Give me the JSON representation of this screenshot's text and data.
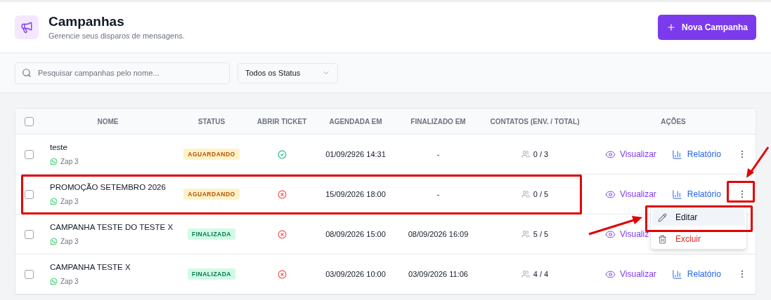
{
  "header": {
    "title": "Campanhas",
    "subtitle": "Gerencie seus disparos de mensagens.",
    "new_button": "Nova Campanha"
  },
  "filters": {
    "search_placeholder": "Pesquisar campanhas pelo nome...",
    "status_select": "Todos os Status"
  },
  "table": {
    "select_all_checked": false,
    "columns": [
      "NOME",
      "STATUS",
      "ABRIR TICKET",
      "AGENDADA EM",
      "FINALIZADO EM",
      "CONTATOS (ENV. / TOTAL)",
      "AÇÕES"
    ],
    "rows": [
      {
        "checked": false,
        "name": "teste",
        "connection": "Zap 3",
        "status": {
          "kind": "pending",
          "label": "AGUARDANDO"
        },
        "open_ticket": true,
        "scheduled": "01/09/2926 14:31",
        "finished": "-",
        "contacts": "0 / 3",
        "actions": [
          {
            "kind": "view",
            "label": "Visualizar"
          },
          {
            "kind": "report",
            "label": "Relatório"
          }
        ],
        "more_button": true
      },
      {
        "checked": false,
        "name": "PROMOÇÃO SETEMBRO 2026",
        "connection": "Zap 3",
        "status": {
          "kind": "pending",
          "label": "AGUARDANDO"
        },
        "open_ticket": false,
        "scheduled": "15/09/2026 18:00",
        "finished": "-",
        "contacts": "0 / 5",
        "actions": [
          {
            "kind": "view",
            "label": "Visualizar"
          },
          {
            "kind": "report",
            "label": "Relatório"
          }
        ],
        "more_button": true
      },
      {
        "checked": false,
        "name": "CAMPANHA TESTE DO TESTE X",
        "connection": "Zap 3",
        "status": {
          "kind": "done",
          "label": "FINALIZADA"
        },
        "open_ticket": false,
        "scheduled": "08/09/2026 15:00",
        "finished": "08/09/2026 16:09",
        "contacts": "5 / 5",
        "actions": [
          {
            "kind": "view",
            "label": "Visualiz"
          }
        ],
        "more_button": false
      },
      {
        "checked": false,
        "name": "CAMPANHA TESTE X",
        "connection": "Zap 3",
        "status": {
          "kind": "done",
          "label": "FINALIZADA"
        },
        "open_ticket": false,
        "scheduled": "03/09/2026 10:00",
        "finished": "03/09/2026 11:06",
        "contacts": "4 / 4",
        "actions": [
          {
            "kind": "view",
            "label": "Visualizar"
          },
          {
            "kind": "report",
            "label": "Relatório"
          }
        ],
        "more_button": true
      }
    ]
  },
  "row_menu": {
    "items": [
      {
        "kind": "edit",
        "label": "Editar",
        "highlighted": true
      },
      {
        "kind": "delete",
        "label": "Excluir",
        "highlighted": false
      }
    ]
  }
}
